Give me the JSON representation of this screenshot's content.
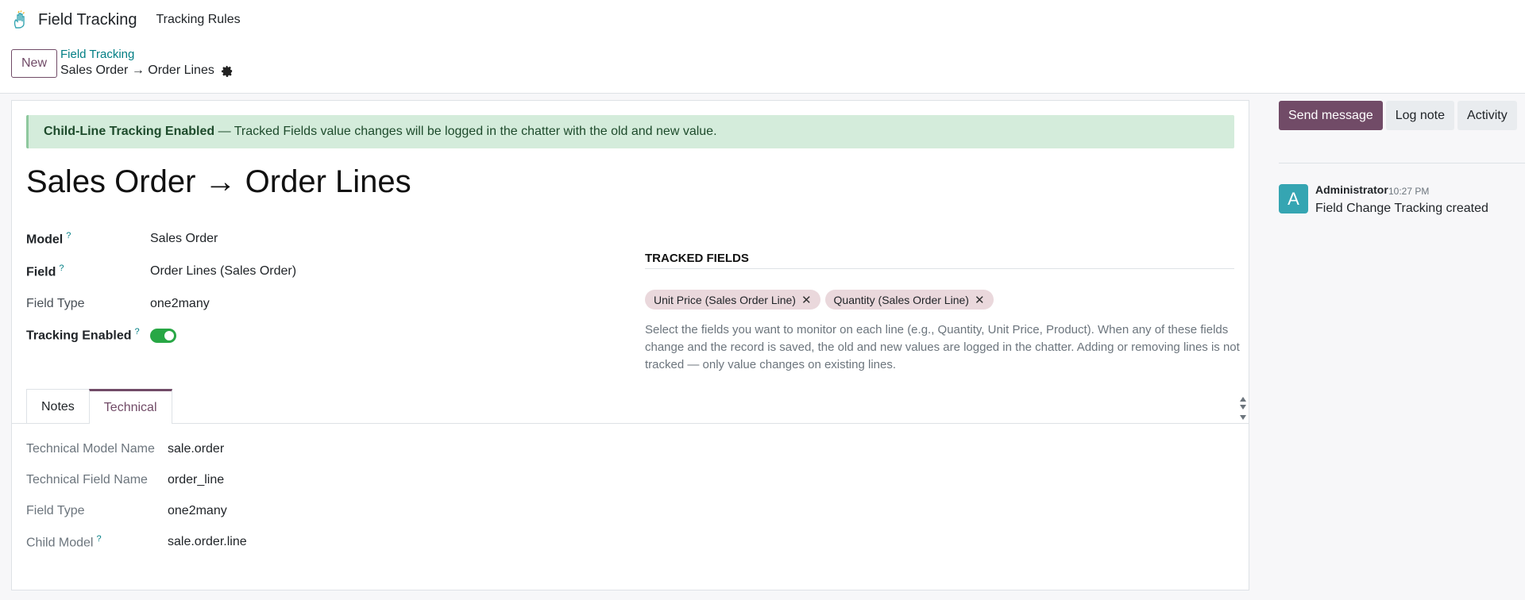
{
  "navbar": {
    "app_name": "Field Tracking",
    "menu_item": "Tracking Rules"
  },
  "control_panel": {
    "new_label": "New",
    "breadcrumb_parent": "Field Tracking",
    "breadcrumb_current": "Sales Order → Order Lines"
  },
  "alert": {
    "strong_text": "Child-Line Tracking Enabled",
    "text": " — Tracked Fields value changes will be logged in the chatter with the old and new value."
  },
  "record": {
    "title": "Sales Order → Order Lines",
    "fields": {
      "model_label": "Model",
      "model_help": "?",
      "model_value": "Sales Order",
      "field_label": "Field",
      "field_help": "?",
      "field_value": "Order Lines (Sales Order)",
      "field_type_label": "Field Type",
      "field_type_value": "one2many",
      "tracking_label": "Tracking Enabled",
      "tracking_help": "?",
      "tracking_enabled": true
    },
    "tracked_fields": {
      "header": "TRACKED FIELDS",
      "tags": [
        "Unit Price (Sales Order Line)",
        "Quantity (Sales Order Line)"
      ],
      "help_text": "Select the fields you want to monitor on each line (e.g., Quantity, Unit Price, Product). When any of these fields change and the record is saved, the old and new values are logged in the chatter. Adding or removing lines is not tracked — only value changes on existing lines."
    }
  },
  "notebook": {
    "tabs": [
      {
        "label": "Notes",
        "active": false
      },
      {
        "label": "Technical",
        "active": true
      }
    ],
    "technical": {
      "model_name_label": "Technical Model Name",
      "model_name_value": "sale.order",
      "field_name_label": "Technical Field Name",
      "field_name_value": "order_line",
      "field_type_label": "Field Type",
      "field_type_value": "one2many",
      "child_model_label": "Child Model",
      "child_model_help": "?",
      "child_model_value": "sale.order.line"
    }
  },
  "chatter": {
    "send_message_label": "Send message",
    "log_note_label": "Log note",
    "activity_label": "Activity",
    "messages": [
      {
        "avatar_letter": "A",
        "author": "Administrator",
        "time": "10:27 PM",
        "body": "Field Change Tracking created"
      }
    ]
  },
  "colors": {
    "brand": "#714b67",
    "link": "#017e84",
    "success": "#28a745",
    "alert_bg": "#d4ecdb",
    "avatar": "#35a5b2"
  }
}
